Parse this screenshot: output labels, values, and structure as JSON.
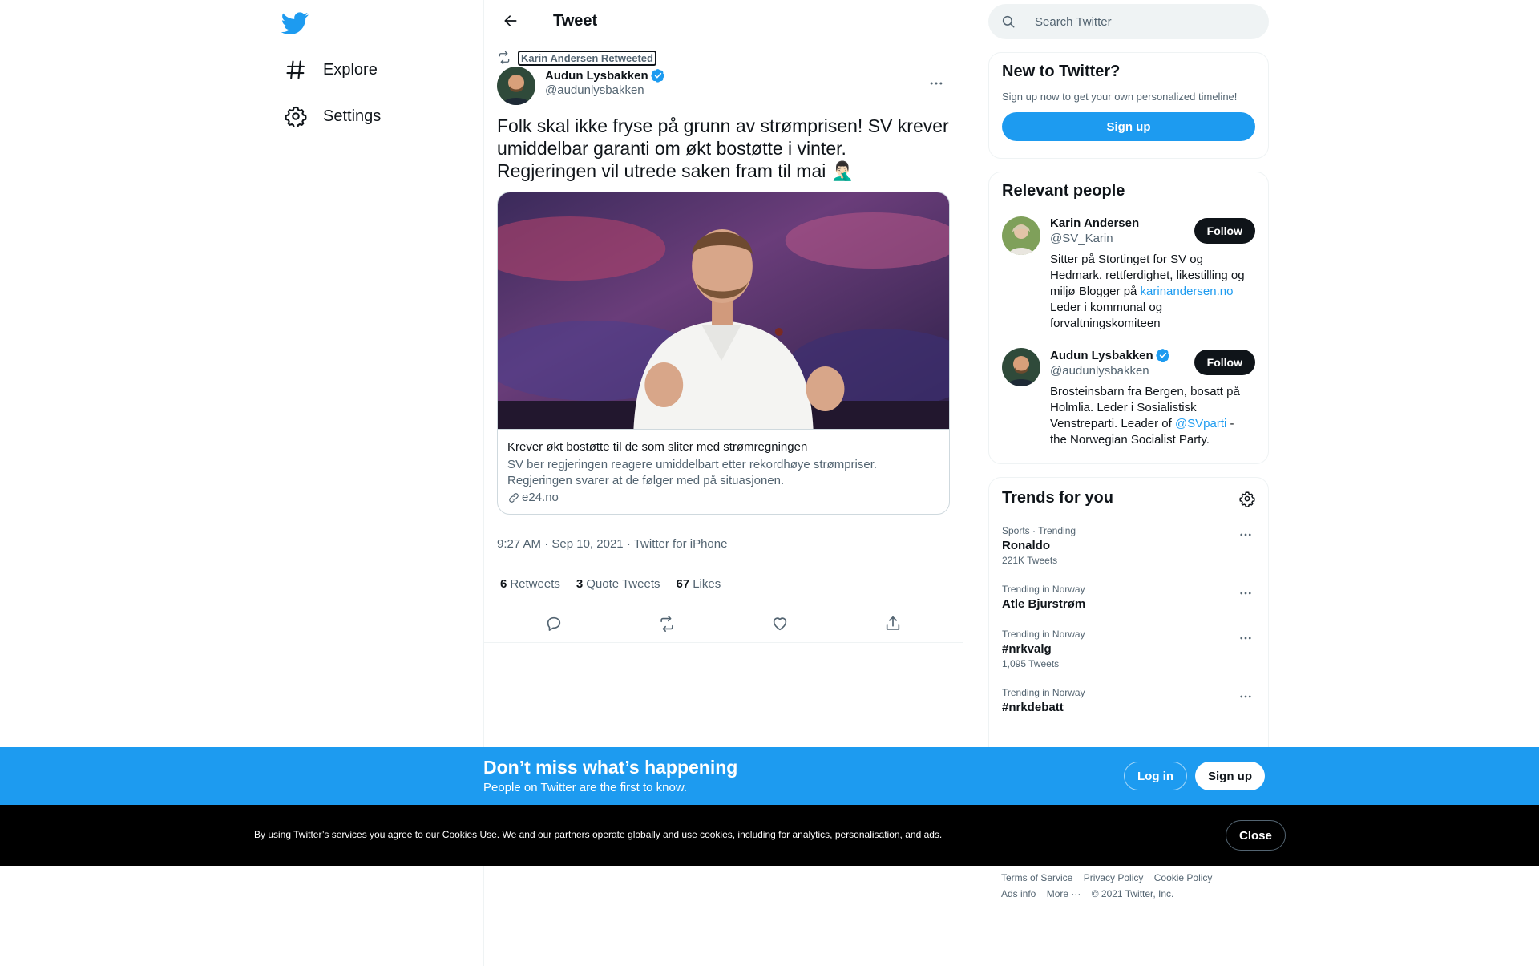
{
  "nav": {
    "items": [
      {
        "label": "Explore",
        "icon": "hashtag-icon"
      },
      {
        "label": "Settings",
        "icon": "gear-icon"
      }
    ]
  },
  "header": {
    "title": "Tweet"
  },
  "tweet": {
    "retweeted_by": "Karin Andersen Retweeted",
    "author_name": "Audun Lysbakken",
    "author_handle": "@audunlysbakken",
    "text": "Folk skal ikke fryse på grunn av strømprisen! SV krever umiddelbar garanti om økt bostøtte i vinter. Regjeringen vil utrede saken fram til mai 🤦🏻‍♂️",
    "card": {
      "title": "Krever økt bostøtte til de som sliter med strømregningen",
      "description": "SV ber regjeringen reagere umiddelbart etter rekordhøye strømpriser. Regjeringen svarer at de følger med på situasjonen.",
      "domain": "e24.no"
    },
    "time": "9:27 AM",
    "date": "Sep 10, 2021",
    "source": "Twitter for iPhone",
    "sep": "·",
    "stats": [
      {
        "count": "6",
        "label": "Retweets"
      },
      {
        "count": "3",
        "label": "Quote Tweets"
      },
      {
        "count": "67",
        "label": "Likes"
      }
    ]
  },
  "search": {
    "placeholder": "Search Twitter"
  },
  "new_to_twitter": {
    "title": "New to Twitter?",
    "subtitle": "Sign up now to get your own personalized timeline!",
    "button": "Sign up"
  },
  "relevant": {
    "title": "Relevant people",
    "people": [
      {
        "name": "Karin Andersen",
        "handle": "@SV_Karin",
        "bio_before": "Sitter på Stortinget for SV og Hedmark. rettferdighet, likestilling og miljø Blogger på ",
        "bio_link": "karinandersen.no",
        "bio_after": " Leder i kommunal og forvaltningskomiteen",
        "button": "Follow"
      },
      {
        "name": "Audun Lysbakken",
        "handle": "@audunlysbakken",
        "bio_before": "Brosteinsbarn fra Bergen, bosatt på Holmlia. Leder i Sosialistisk Venstreparti. Leader of ",
        "bio_link": "@SVparti",
        "bio_after": " - the Norwegian Socialist Party.",
        "button": "Follow"
      }
    ]
  },
  "trends": {
    "title": "Trends for you",
    "items": [
      {
        "category": "Sports · Trending",
        "name": "Ronaldo",
        "count": "221K Tweets"
      },
      {
        "category": "Trending in Norway",
        "name": "Atle Bjurstrøm",
        "count": ""
      },
      {
        "category": "Trending in Norway",
        "name": "#nrkvalg",
        "count": "1,095 Tweets"
      },
      {
        "category": "Trending in Norway",
        "name": "#nrkdebatt",
        "count": ""
      }
    ]
  },
  "footer": {
    "links": [
      "Terms of Service",
      "Privacy Policy",
      "Cookie Policy",
      "Ads info",
      "More ···",
      "© 2021 Twitter, Inc."
    ]
  },
  "promo": {
    "title": "Don’t miss what’s happening",
    "subtitle": "People on Twitter are the first to know.",
    "login": "Log in",
    "signup": "Sign up"
  },
  "cookie": {
    "text": "By using Twitter’s services you agree to our Cookies Use. We and our partners operate globally and use cookies, including for analytics, personalisation, and ads.",
    "close": "Close"
  },
  "colors": {
    "accent": "#1d9bf0",
    "text": "#0f1419",
    "muted": "#536471",
    "border": "#eff3f4"
  }
}
